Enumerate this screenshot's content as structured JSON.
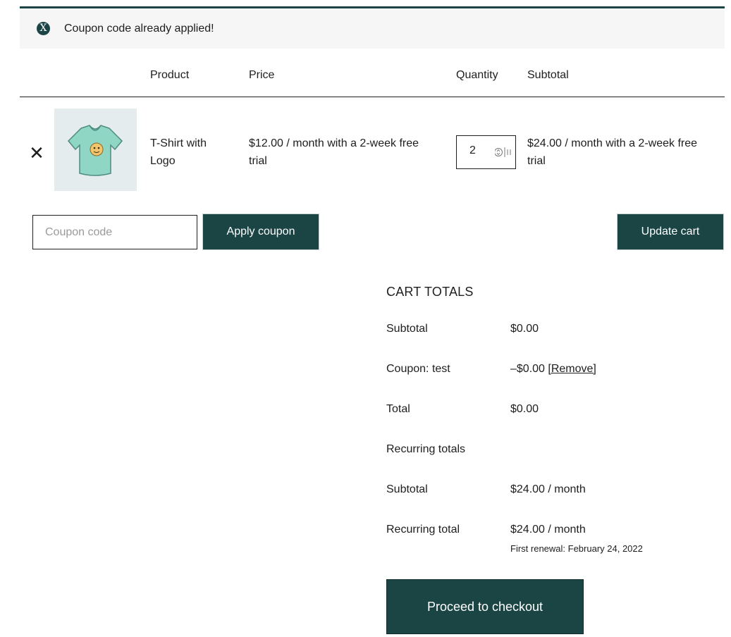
{
  "notice": {
    "icon": "close-circle-icon",
    "text": "Coupon code already applied!"
  },
  "table": {
    "headers": {
      "product": "Product",
      "price": "Price",
      "quantity": "Quantity",
      "subtotal": "Subtotal"
    }
  },
  "item": {
    "remove_icon": "close-icon",
    "name_line1": "T-Shirt with",
    "name_line2": "Logo",
    "price_line1": "$12.00 / month with a 2-week free",
    "price_line2": "trial",
    "quantity": "2",
    "subtotal_line1": "$24.00 / month with a 2-week free",
    "subtotal_line2": "trial"
  },
  "coupon": {
    "placeholder": "Coupon code",
    "apply_label": "Apply coupon"
  },
  "update_label": "Update cart",
  "totals": {
    "title": "CART TOTALS",
    "subtotal_label": "Subtotal",
    "subtotal_value": "$0.00",
    "coupon_label": "Coupon: test",
    "coupon_value": "–$0.00",
    "coupon_remove": "[Remove]",
    "total_label": "Total",
    "total_value": "$0.00",
    "recurring_heading": "Recurring totals",
    "recurring_subtotal_label": "Subtotal",
    "recurring_subtotal_value": "$24.00 / month",
    "recurring_total_label": "Recurring total",
    "recurring_total_value": "$24.00 / month",
    "first_renewal": "First renewal: February 24, 2022"
  },
  "checkout_label": "Proceed to checkout",
  "colors": {
    "accent": "#1b4545",
    "notice_bg": "#f6f6f6",
    "thumb_bg": "#e4ecee"
  }
}
